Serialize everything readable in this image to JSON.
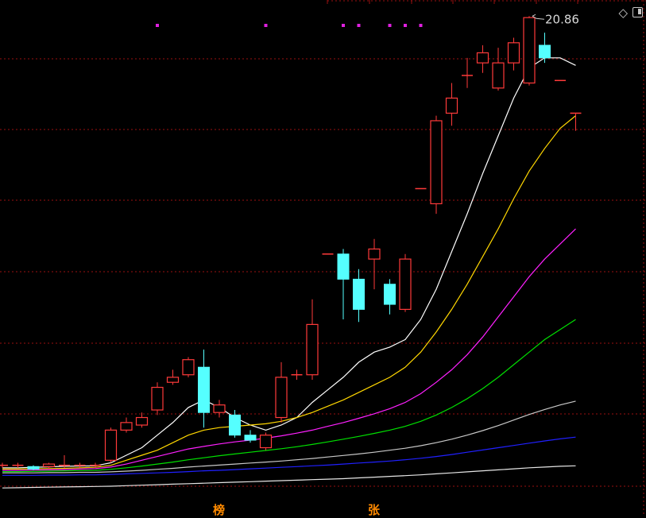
{
  "chart_data": {
    "type": "candlestick",
    "max_label": "20.86",
    "colors": {
      "background": "#000000",
      "up": "#ff3a3a",
      "down": "#55ffff",
      "grid": "#9a1010",
      "marker": "#e020e0"
    },
    "candles": [
      {
        "o": 3.0,
        "c": 3.0,
        "h": 3.1,
        "l": 2.9
      },
      {
        "o": 3.0,
        "c": 3.0,
        "h": 3.1,
        "l": 2.9
      },
      {
        "o": 2.95,
        "c": 2.85,
        "h": 3.0,
        "l": 2.8
      },
      {
        "o": 2.95,
        "c": 3.05,
        "h": 3.1,
        "l": 2.85
      },
      {
        "o": 3.0,
        "c": 3.0,
        "h": 3.4,
        "l": 2.9
      },
      {
        "o": 3.0,
        "c": 3.0,
        "h": 3.1,
        "l": 2.9
      },
      {
        "o": 3.0,
        "c": 3.0,
        "h": 3.1,
        "l": 2.9
      },
      {
        "o": 3.2,
        "c": 4.4,
        "h": 4.5,
        "l": 3.1
      },
      {
        "o": 4.4,
        "c": 4.7,
        "h": 4.9,
        "l": 4.3
      },
      {
        "o": 4.6,
        "c": 4.9,
        "h": 5.1,
        "l": 4.5
      },
      {
        "o": 5.2,
        "c": 6.1,
        "h": 6.3,
        "l": 5.0
      },
      {
        "o": 6.3,
        "c": 6.5,
        "h": 6.8,
        "l": 6.2
      },
      {
        "o": 6.6,
        "c": 7.2,
        "h": 7.3,
        "l": 6.5
      },
      {
        "o": 6.9,
        "c": 5.1,
        "h": 7.6,
        "l": 4.5
      },
      {
        "o": 5.1,
        "c": 5.4,
        "h": 5.6,
        "l": 4.9
      },
      {
        "o": 5.0,
        "c": 4.2,
        "h": 5.2,
        "l": 4.1
      },
      {
        "o": 4.2,
        "c": 4.0,
        "h": 4.4,
        "l": 3.9
      },
      {
        "o": 3.7,
        "c": 4.2,
        "h": 4.3,
        "l": 3.6
      },
      {
        "o": 4.9,
        "c": 6.5,
        "h": 7.1,
        "l": 4.7
      },
      {
        "o": 6.6,
        "c": 6.6,
        "h": 6.8,
        "l": 6.4
      },
      {
        "o": 6.6,
        "c": 8.6,
        "h": 9.6,
        "l": 6.4
      },
      {
        "o": 11.4,
        "c": 11.4,
        "h": 11.4,
        "l": 11.4
      },
      {
        "o": 11.4,
        "c": 10.4,
        "h": 11.6,
        "l": 8.8
      },
      {
        "o": 10.4,
        "c": 9.2,
        "h": 10.8,
        "l": 8.7
      },
      {
        "o": 11.2,
        "c": 11.6,
        "h": 12.0,
        "l": 10.0
      },
      {
        "o": 10.2,
        "c": 9.4,
        "h": 10.4,
        "l": 9.0
      },
      {
        "o": 9.2,
        "c": 11.2,
        "h": 11.4,
        "l": 9.1
      },
      {
        "o": 14.0,
        "c": 14.0,
        "h": 14.0,
        "l": 14.0
      },
      {
        "o": 13.4,
        "c": 16.7,
        "h": 16.9,
        "l": 13.0
      },
      {
        "o": 17.0,
        "c": 17.6,
        "h": 18.2,
        "l": 16.5
      },
      {
        "o": 18.5,
        "c": 18.5,
        "h": 19.2,
        "l": 18.0
      },
      {
        "o": 19.0,
        "c": 19.4,
        "h": 19.7,
        "l": 18.6
      },
      {
        "o": 18.0,
        "c": 19.0,
        "h": 19.6,
        "l": 17.9
      },
      {
        "o": 19.0,
        "c": 19.8,
        "h": 20.0,
        "l": 18.7
      },
      {
        "o": 18.2,
        "c": 20.8,
        "h": 20.86,
        "l": 18.1
      },
      {
        "o": 19.7,
        "c": 19.2,
        "h": 20.2,
        "l": 19.0
      },
      {
        "o": 18.3,
        "c": 18.3,
        "h": 18.3,
        "l": 18.3
      },
      {
        "o": 17.0,
        "c": 17.0,
        "h": 17.0,
        "l": 16.3
      }
    ],
    "moving_averages": [
      {
        "color": "#ffffff",
        "values": [
          2.9,
          2.9,
          2.92,
          2.94,
          2.96,
          2.97,
          2.98,
          3.1,
          3.4,
          3.7,
          4.2,
          4.7,
          5.3,
          5.6,
          5.3,
          4.9,
          4.6,
          4.4,
          4.6,
          4.9,
          5.5,
          6.0,
          6.5,
          7.1,
          7.5,
          7.7,
          8.0,
          8.8,
          10.0,
          11.5,
          13.0,
          14.6,
          16.1,
          17.6,
          18.8,
          19.2,
          19.2,
          18.9
        ]
      },
      {
        "color": "#ffd700",
        "values": [
          2.85,
          2.85,
          2.86,
          2.87,
          2.88,
          2.9,
          2.92,
          3.0,
          3.2,
          3.4,
          3.6,
          3.9,
          4.2,
          4.4,
          4.5,
          4.55,
          4.6,
          4.65,
          4.75,
          4.9,
          5.1,
          5.35,
          5.6,
          5.9,
          6.2,
          6.5,
          6.9,
          7.5,
          8.3,
          9.2,
          10.2,
          11.3,
          12.4,
          13.6,
          14.7,
          15.6,
          16.4,
          16.9
        ]
      },
      {
        "color": "#ff20ff",
        "values": [
          2.8,
          2.8,
          2.81,
          2.82,
          2.83,
          2.85,
          2.87,
          2.93,
          3.05,
          3.2,
          3.35,
          3.5,
          3.65,
          3.75,
          3.85,
          3.93,
          4.0,
          4.08,
          4.17,
          4.28,
          4.4,
          4.55,
          4.7,
          4.87,
          5.05,
          5.25,
          5.5,
          5.85,
          6.3,
          6.8,
          7.4,
          8.1,
          8.9,
          9.7,
          10.5,
          11.2,
          11.8,
          12.4
        ]
      },
      {
        "color": "#00e000",
        "values": [
          2.75,
          2.75,
          2.76,
          2.77,
          2.78,
          2.79,
          2.8,
          2.84,
          2.9,
          2.97,
          3.05,
          3.13,
          3.22,
          3.3,
          3.38,
          3.45,
          3.52,
          3.59,
          3.66,
          3.74,
          3.83,
          3.93,
          4.04,
          4.15,
          4.27,
          4.4,
          4.55,
          4.75,
          5.0,
          5.3,
          5.65,
          6.05,
          6.5,
          7.0,
          7.5,
          8.0,
          8.4,
          8.8
        ]
      },
      {
        "color": "#c8c8c8",
        "values": [
          2.7,
          2.7,
          2.7,
          2.71,
          2.71,
          2.72,
          2.72,
          2.74,
          2.77,
          2.8,
          2.84,
          2.88,
          2.93,
          2.97,
          3.01,
          3.05,
          3.09,
          3.13,
          3.17,
          3.22,
          3.27,
          3.33,
          3.39,
          3.45,
          3.52,
          3.6,
          3.68,
          3.78,
          3.9,
          4.04,
          4.2,
          4.38,
          4.58,
          4.8,
          5.02,
          5.22,
          5.4,
          5.55
        ]
      },
      {
        "color": "#2020ff",
        "values": [
          2.6,
          2.6,
          2.6,
          2.61,
          2.61,
          2.62,
          2.62,
          2.64,
          2.66,
          2.68,
          2.7,
          2.72,
          2.75,
          2.78,
          2.8,
          2.83,
          2.86,
          2.89,
          2.92,
          2.95,
          2.98,
          3.01,
          3.05,
          3.09,
          3.13,
          3.17,
          3.22,
          3.28,
          3.35,
          3.43,
          3.52,
          3.61,
          3.7,
          3.79,
          3.88,
          3.97,
          4.05,
          4.12
        ]
      },
      {
        "color": "#e6e6e6",
        "values": [
          2.1,
          2.11,
          2.12,
          2.13,
          2.14,
          2.15,
          2.16,
          2.17,
          2.19,
          2.21,
          2.23,
          2.25,
          2.27,
          2.29,
          2.31,
          2.33,
          2.35,
          2.37,
          2.39,
          2.41,
          2.43,
          2.45,
          2.47,
          2.5,
          2.53,
          2.56,
          2.59,
          2.62,
          2.66,
          2.7,
          2.74,
          2.78,
          2.82,
          2.86,
          2.9,
          2.93,
          2.96,
          2.98
        ]
      }
    ],
    "marker_candle_indices": [
      10,
      17,
      22,
      23,
      25,
      26,
      27
    ],
    "bottom_tags": [
      {
        "text": "榜",
        "color": "#ff8a00",
        "candle_index": 14
      },
      {
        "text": "张",
        "color": "#ff8a00",
        "candle_index": 24
      }
    ],
    "y_range": [
      1.6,
      21.5
    ]
  },
  "toolbar": {
    "diamond_glyph": "◇"
  }
}
